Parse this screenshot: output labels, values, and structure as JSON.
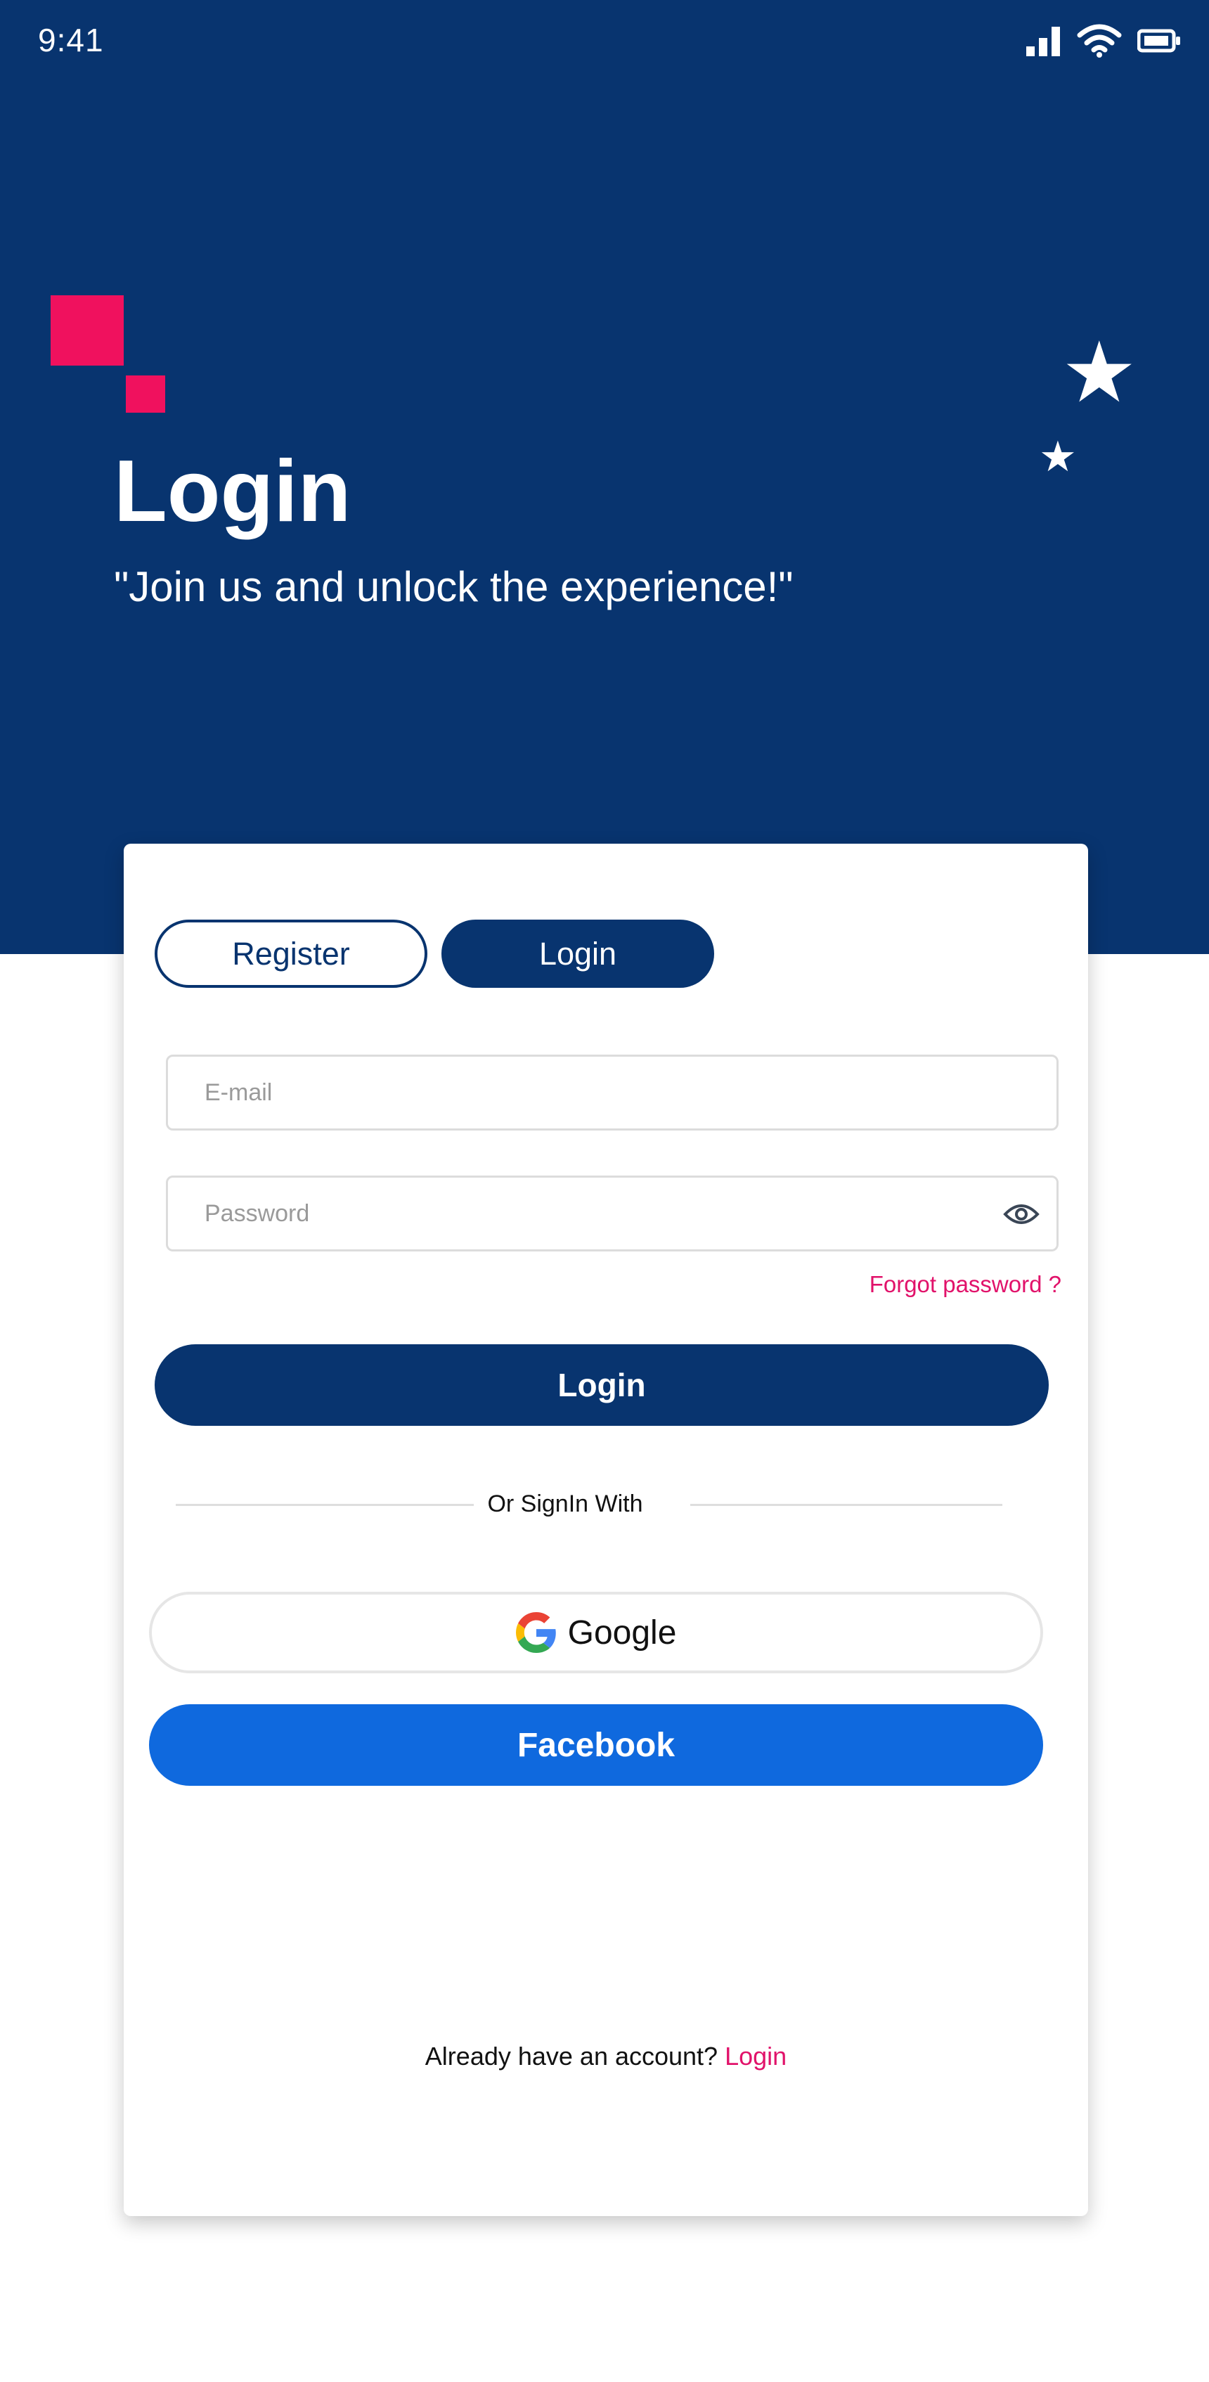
{
  "status_bar": {
    "time": "9:41",
    "icons": [
      "signal-icon",
      "wifi-icon",
      "battery-icon"
    ]
  },
  "hero": {
    "title": "Login",
    "tagline": "\"Join us and unlock the experience!\"",
    "background_color": "#08346f",
    "accent_color": "#f0115e",
    "decorations": [
      "star-icon",
      "star-icon"
    ]
  },
  "tabs": [
    {
      "label": "Register",
      "active": false
    },
    {
      "label": "Login",
      "active": true
    }
  ],
  "form": {
    "email_placeholder": "E-mail",
    "email_value": "",
    "password_placeholder": "Password",
    "password_value": "",
    "forgot_password": "Forgot password  ?"
  },
  "login_button": "Login",
  "divider_text": "Or SignIn With",
  "social": {
    "google_label": "Google",
    "facebook_label": "Facebook",
    "facebook_color": "#0f69de"
  },
  "footer": {
    "prompt": "Already have an account?",
    "link": "Login",
    "link_color": "#e1126a"
  }
}
